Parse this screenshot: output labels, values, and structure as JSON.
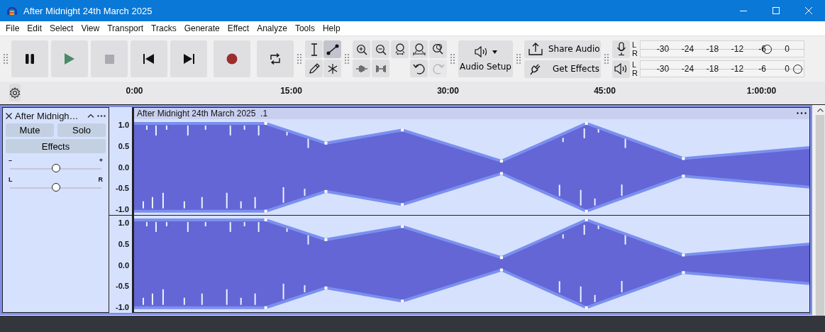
{
  "window": {
    "title": "After Midnight 24th March 2025"
  },
  "menu": [
    "File",
    "Edit",
    "Select",
    "View",
    "Transport",
    "Tracks",
    "Generate",
    "Effect",
    "Analyze",
    "Tools",
    "Help"
  ],
  "transport": [
    {
      "kind": "pause"
    },
    {
      "kind": "play"
    },
    {
      "kind": "stop"
    },
    {
      "kind": "skip-start"
    },
    {
      "kind": "skip-end"
    },
    {
      "kind": "record"
    },
    {
      "kind": "loop"
    }
  ],
  "tools": [
    {
      "kind": "select",
      "selected": false
    },
    {
      "kind": "envelope",
      "selected": true
    },
    {
      "kind": "draw",
      "selected": false
    },
    {
      "kind": "multi",
      "selected": false
    }
  ],
  "edit_buttons": [
    {
      "kind": "zoom-in",
      "disabled": false
    },
    {
      "kind": "zoom-out",
      "disabled": false
    },
    {
      "kind": "fit-selection",
      "disabled": false
    },
    {
      "kind": "fit-project",
      "disabled": false
    },
    {
      "kind": "zoom-toggle",
      "disabled": false
    },
    {
      "kind": "trim",
      "disabled": false
    },
    {
      "kind": "silence",
      "disabled": false
    },
    {
      "kind": "undo",
      "disabled": false
    },
    {
      "kind": "redo",
      "disabled": true
    }
  ],
  "audio_setup": {
    "label": "Audio Setup"
  },
  "share_audio": {
    "label": "Share Audio"
  },
  "get_effects": {
    "label": "Get Effects"
  },
  "meters": [
    {
      "kind": "record",
      "top_channel": "L",
      "bottom_channel": "R",
      "ticks": [
        "-30",
        "-24",
        "-18",
        "-12",
        "-6",
        "0"
      ],
      "level": 0.8
    },
    {
      "kind": "playback",
      "top_channel": "L",
      "bottom_channel": "R",
      "ticks": [
        "-30",
        "-24",
        "-18",
        "-12",
        "-6",
        "0"
      ],
      "level": 1.0
    }
  ],
  "ruler": {
    "ticks": [
      "0:00",
      "15:00",
      "30:00",
      "45:00",
      "1:00:00"
    ]
  },
  "track": {
    "name": "After Midnigh…",
    "mute": "Mute",
    "solo": "Solo",
    "effects": "Effects",
    "gain": {
      "min_label": "–",
      "max_label": "+",
      "level": 0.5
    },
    "pan": {
      "left_label": "L",
      "right_label": "R",
      "level": 0.5
    },
    "clip_title": "After Midnight 24th March 2025  .1",
    "channels": [
      {
        "scale": [
          "1.0",
          "0.5",
          "0.0",
          "-0.5",
          "-1.0"
        ]
      },
      {
        "scale": [
          "1.0",
          "0.5",
          "0.0",
          "-0.5",
          "-1.0"
        ]
      }
    ]
  }
}
